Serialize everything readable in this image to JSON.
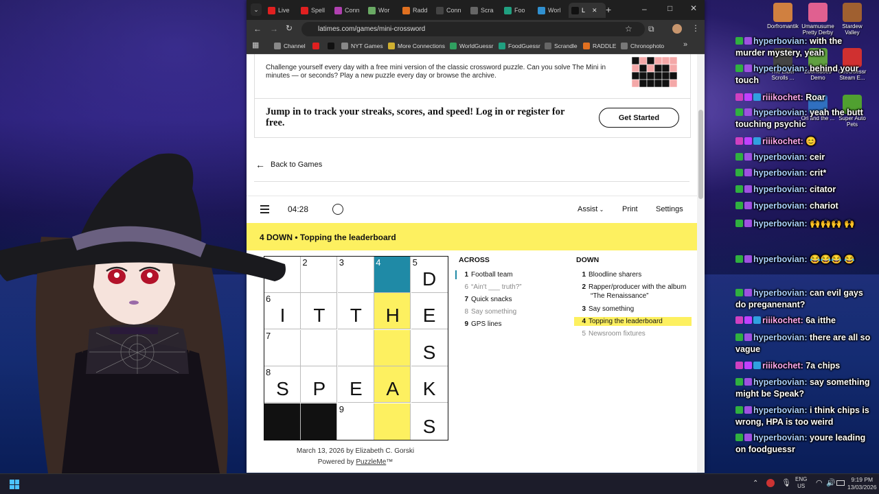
{
  "browser": {
    "tabs": [
      {
        "label": "Live",
        "favicon_color": "#e02020"
      },
      {
        "label": "Spell",
        "favicon_color": "#e02020"
      },
      {
        "label": "Conn",
        "favicon_color": "#b040b0"
      },
      {
        "label": "Wor",
        "favicon_color": "#6aaa64"
      },
      {
        "label": "Radd",
        "favicon_color": "#e07020"
      },
      {
        "label": "Conn",
        "favicon_color": "#444444"
      },
      {
        "label": "Scra",
        "favicon_color": "#666666"
      },
      {
        "label": "Foo",
        "favicon_color": "#20a080"
      },
      {
        "label": "Worl",
        "favicon_color": "#3090d0"
      },
      {
        "label": "L",
        "favicon_color": "#111111"
      }
    ],
    "url": "latimes.com/games/mini-crossword",
    "bookmarks": [
      {
        "label": "Channel",
        "color": "#888888"
      },
      {
        "label": "",
        "color": "#e02020"
      },
      {
        "label": "",
        "color": "#111111"
      },
      {
        "label": "NYT Games",
        "color": "#888888"
      },
      {
        "label": "More Connections",
        "color": "#d0b030"
      },
      {
        "label": "WorldGuessr",
        "color": "#30a060"
      },
      {
        "label": "FoodGuessr",
        "color": "#20a080"
      },
      {
        "label": "Scrandle",
        "color": "#666666"
      },
      {
        "label": "RADDLE",
        "color": "#e07020"
      },
      {
        "label": "Chronophoto",
        "color": "#777777"
      }
    ]
  },
  "promo": {
    "description": "Challenge yourself every day with a free mini version of the classic crossword puzzle. Can you solve The Mini in minutes — or seconds? Play a new puzzle every day or browse the archive.",
    "jump_text": "Jump in to track your streaks, scores, and speed! Log in or register for free.",
    "cta": "Get Started"
  },
  "nav": {
    "back_label": "Back to Games"
  },
  "toolbar": {
    "timer": "04:28",
    "assist": "Assist",
    "print": "Print",
    "settings": "Settings"
  },
  "current_clue": {
    "label": "4 DOWN  •  Topping the leaderboard"
  },
  "grid": {
    "cells": [
      {
        "num": "1",
        "letter": "",
        "state": "normal"
      },
      {
        "num": "2",
        "letter": "",
        "state": "normal"
      },
      {
        "num": "3",
        "letter": "",
        "state": "normal"
      },
      {
        "num": "4",
        "letter": "",
        "state": "selected"
      },
      {
        "num": "5",
        "letter": "D",
        "state": "normal"
      },
      {
        "num": "6",
        "letter": "I",
        "state": "normal"
      },
      {
        "num": "",
        "letter": "T",
        "state": "normal"
      },
      {
        "num": "",
        "letter": "T",
        "state": "normal"
      },
      {
        "num": "",
        "letter": "H",
        "state": "highlight"
      },
      {
        "num": "",
        "letter": "E",
        "state": "normal"
      },
      {
        "num": "7",
        "letter": "",
        "state": "normal"
      },
      {
        "num": "",
        "letter": "",
        "state": "normal"
      },
      {
        "num": "",
        "letter": "",
        "state": "normal"
      },
      {
        "num": "",
        "letter": "",
        "state": "highlight"
      },
      {
        "num": "",
        "letter": "S",
        "state": "normal"
      },
      {
        "num": "8",
        "letter": "S",
        "state": "normal"
      },
      {
        "num": "",
        "letter": "P",
        "state": "normal"
      },
      {
        "num": "",
        "letter": "E",
        "state": "normal"
      },
      {
        "num": "",
        "letter": "A",
        "state": "highlight"
      },
      {
        "num": "",
        "letter": "K",
        "state": "normal"
      },
      {
        "num": "",
        "letter": "",
        "state": "block"
      },
      {
        "num": "",
        "letter": "",
        "state": "block"
      },
      {
        "num": "9",
        "letter": "",
        "state": "normal"
      },
      {
        "num": "",
        "letter": "",
        "state": "highlight"
      },
      {
        "num": "",
        "letter": "S",
        "state": "normal"
      }
    ]
  },
  "byline": {
    "date_author": "March 13, 2026 by Elizabeth C. Gorski",
    "powered_prefix": "Powered by ",
    "powered_link": "PuzzleMe",
    "powered_suffix": "™"
  },
  "clues": {
    "across_heading": "ACROSS",
    "down_heading": "DOWN",
    "across": [
      {
        "num": "1",
        "text": "Football team",
        "state": "current"
      },
      {
        "num": "6",
        "text": "“Ain't ___ truth?”",
        "state": "done"
      },
      {
        "num": "7",
        "text": "Quick snacks",
        "state": "normal"
      },
      {
        "num": "8",
        "text": "Say something",
        "state": "done"
      },
      {
        "num": "9",
        "text": "GPS lines",
        "state": "normal"
      }
    ],
    "down": [
      {
        "num": "1",
        "text": "Bloodline sharers",
        "state": "normal"
      },
      {
        "num": "2",
        "text": "Rapper/producer with the album “The Renaissance”",
        "state": "normal"
      },
      {
        "num": "3",
        "text": "Say something",
        "state": "normal"
      },
      {
        "num": "4",
        "text": "Topping the leaderboard",
        "state": "active"
      },
      {
        "num": "5",
        "text": "Newsroom fixtures",
        "state": "done"
      }
    ]
  },
  "chat": [
    {
      "user": "hyperbovian:",
      "msg": "with the murder mystery, yeah",
      "color": "blue"
    },
    {
      "user": "hyperbovian:",
      "msg": "behind your touch",
      "color": "blue"
    },
    {
      "user": "riiikochet:",
      "msg": "Roar",
      "color": "pink"
    },
    {
      "user": "hyperbovian:",
      "msg": "yeah the butt touching psychic",
      "color": "blue"
    },
    {
      "user": "riiikochet:",
      "msg": "😊",
      "color": "pink"
    },
    {
      "user": "hyperbovian:",
      "msg": "ceir",
      "color": "blue"
    },
    {
      "user": "hyperbovian:",
      "msg": "crit*",
      "color": "blue"
    },
    {
      "user": "hyperbovian:",
      "msg": "citator",
      "color": "blue"
    },
    {
      "user": "hyperbovian:",
      "msg": "chariot",
      "color": "blue"
    },
    {
      "user": "hyperbovian:",
      "msg": "🙌🙌🙌 🙌",
      "color": "blue"
    },
    {
      "user": "hyperbovian:",
      "msg": "😂😂😂 😂",
      "color": "blue"
    },
    {
      "user": "hyperbovian:",
      "msg": "can evil gays do preganenant?",
      "color": "blue"
    },
    {
      "user": "riiikochet:",
      "msg": "6a itthe",
      "color": "pink"
    },
    {
      "user": "hyperbovian:",
      "msg": "there are all so vague",
      "color": "blue"
    },
    {
      "user": "riiikochet:",
      "msg": "7a chips",
      "color": "pink"
    },
    {
      "user": "hyperbovian:",
      "msg": "say something might be Speak?",
      "color": "blue"
    },
    {
      "user": "hyperbovian:",
      "msg": "i think chips is wrong, HPA is too weird",
      "color": "blue"
    },
    {
      "user": "hyperbovian:",
      "msg": "youre leading on foodguessr",
      "color": "blue"
    }
  ],
  "desktop_icons": [
    {
      "label": "Dorfromantik",
      "color": "#d08040"
    },
    {
      "label": "Umamusume Pretty Derby",
      "color": "#e06090"
    },
    {
      "label": "Stardew Valley",
      "color": "#a06030"
    },
    {
      "label": "The Elder Scrolls ...",
      "color": "#444444"
    },
    {
      "label": "Zoomidoes Demo",
      "color": "#60a040"
    },
    {
      "label": "GeoGuessr Steam E...",
      "color": "#d03030"
    },
    {
      "label": "Ori and the ...",
      "color": "#3070c0"
    },
    {
      "label": "Super Auto Pets",
      "color": "#50a030"
    }
  ],
  "taskbar": {
    "lang": "ENG",
    "region": "US",
    "time": "9:19 PM",
    "date": "13/03/2026"
  }
}
